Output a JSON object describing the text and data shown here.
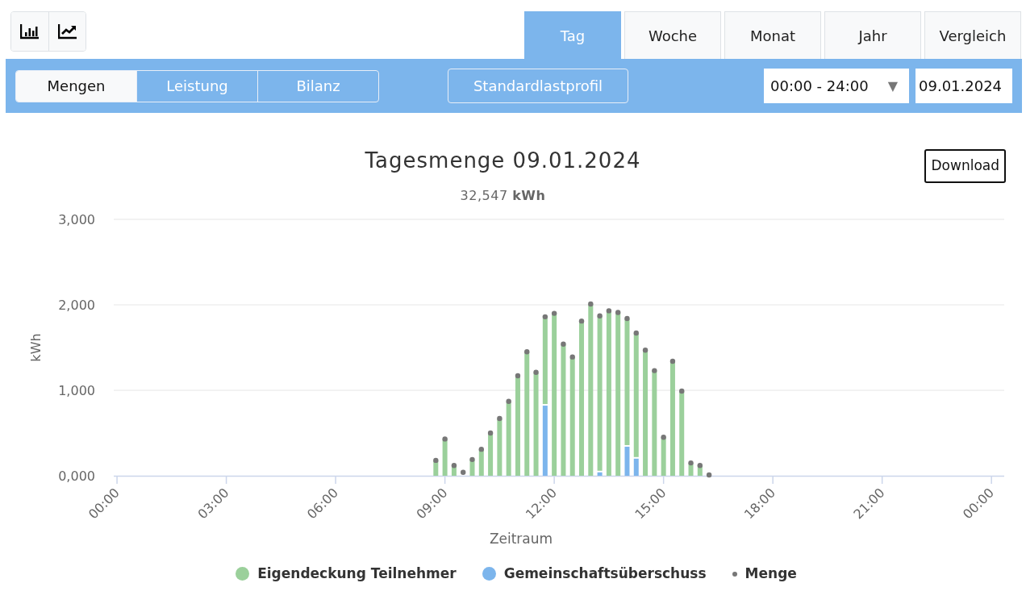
{
  "chart_type_buttons": [
    {
      "kind": "bar"
    },
    {
      "kind": "line"
    }
  ],
  "period_tabs": [
    {
      "label": "Tag",
      "selected": true
    },
    {
      "label": "Woche",
      "selected": false
    },
    {
      "label": "Monat",
      "selected": false
    },
    {
      "label": "Jahr",
      "selected": false
    },
    {
      "label": "Vergleich",
      "selected": false
    }
  ],
  "view_buttons": [
    {
      "label": "Mengen",
      "selected": true
    },
    {
      "label": "Leistung",
      "selected": false
    },
    {
      "label": "Bilanz",
      "selected": false
    }
  ],
  "profile_button": "Standardlastprofil",
  "time_range": {
    "value": "00:00 - 24:00",
    "arrow": "▼"
  },
  "date_field": {
    "value": "09.01.2024"
  },
  "chart": {
    "title": "Tagesmenge 09.01.2024",
    "subtitle": "32,547 **kWh**",
    "download": "Download",
    "chart_data": {
      "type": "bar",
      "stacked": true,
      "xlabel": "Zeitraum",
      "ylabel": "kWh",
      "x": [
        8.75,
        9,
        9.25,
        9.5,
        9.75,
        10,
        10.25,
        10.5,
        10.75,
        11,
        11.25,
        11.5,
        11.75,
        12,
        12.25,
        12.5,
        12.75,
        13,
        13.25,
        13.5,
        13.75,
        14,
        14.25,
        14.5,
        14.75,
        15,
        15.25,
        15.5,
        15.75,
        16,
        16.25
      ],
      "xlim": [
        -0.09,
        24.35
      ],
      "ylim": [
        0,
        3000
      ],
      "xticks": [
        {
          "value": 0,
          "label": "00:00"
        },
        {
          "value": 3,
          "label": "03:00"
        },
        {
          "value": 6,
          "label": "06:00"
        },
        {
          "value": 9,
          "label": "09:00"
        },
        {
          "value": 12,
          "label": "12:00"
        },
        {
          "value": 15,
          "label": "15:00"
        },
        {
          "value": 18,
          "label": "18:00"
        },
        {
          "value": 21,
          "label": "21:00"
        },
        {
          "value": 24,
          "label": "00:00"
        }
      ],
      "yticks": [
        {
          "value": 0,
          "label": "0,000"
        },
        {
          "value": 1000,
          "label": "1,000"
        },
        {
          "value": 2000,
          "label": "2,000"
        },
        {
          "value": 3000,
          "label": "3,000"
        }
      ],
      "series": [
        {
          "name": "Eigendeckung Teilnehmer",
          "color": "#9bd09b",
          "type": "bar",
          "values": [
            180,
            430,
            120,
            null,
            190,
            310,
            500,
            670,
            870,
            1170,
            1450,
            1210,
            1040,
            1900,
            1540,
            1390,
            1810,
            2010,
            1830,
            1930,
            1910,
            1500,
            1470,
            1470,
            1230,
            450,
            1340,
            990,
            150,
            120,
            null
          ]
        },
        {
          "name": "Gemeinschaftsüberschuss",
          "color": "#7cb5ec",
          "type": "bar",
          "values": [
            0,
            0,
            0,
            0,
            0,
            0,
            0,
            0,
            0,
            0,
            0,
            0,
            820,
            0,
            0,
            0,
            0,
            0,
            40,
            0,
            0,
            340,
            200,
            0,
            0,
            0,
            0,
            0,
            0,
            0,
            0
          ]
        },
        {
          "name": "Menge",
          "color": "#777777",
          "type": "scatter",
          "values": [
            180,
            430,
            120,
            40,
            190,
            310,
            500,
            670,
            870,
            1170,
            1450,
            1210,
            1860,
            1900,
            1540,
            1390,
            1810,
            2010,
            1870,
            1930,
            1910,
            1840,
            1670,
            1470,
            1230,
            450,
            1340,
            990,
            150,
            120,
            10
          ]
        }
      ]
    }
  }
}
